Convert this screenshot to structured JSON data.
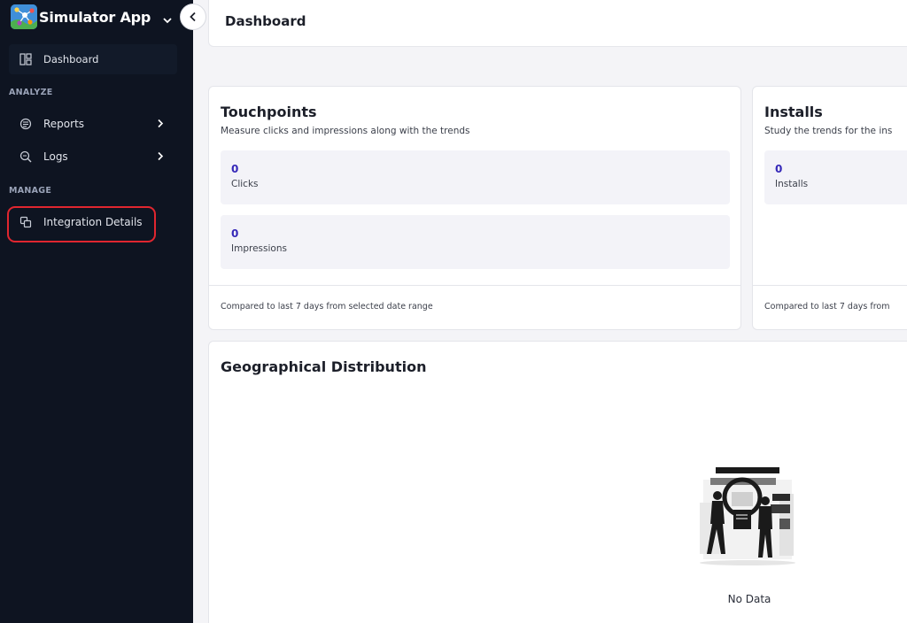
{
  "app": {
    "name": "Simulator App",
    "logo_icon": "network-graph-icon",
    "switcher_icon": "chevron-down-icon"
  },
  "sidebar": {
    "collapse_icon": "chevron-left-icon",
    "items": [
      {
        "label": "Dashboard",
        "icon": "dashboard-layout-icon",
        "active": true
      },
      {
        "label": "Reports",
        "icon": "report-icon",
        "has_submenu": true
      },
      {
        "label": "Logs",
        "icon": "search-log-icon",
        "has_submenu": true
      },
      {
        "label": "Integration Details",
        "icon": "copy-integration-icon",
        "highlighted": true
      }
    ],
    "sections": {
      "analyze": "ANALYZE",
      "manage": "MANAGE"
    }
  },
  "header": {
    "title": "Dashboard"
  },
  "touchpoints": {
    "title": "Touchpoints",
    "subtitle": "Measure clicks and impressions along with the trends",
    "metrics": [
      {
        "value": "0",
        "label": "Clicks"
      },
      {
        "value": "0",
        "label": "Impressions"
      }
    ],
    "footer": "Compared to last 7 days from selected date range"
  },
  "installs": {
    "title": "Installs",
    "subtitle": "Study the trends for the ins",
    "metrics": [
      {
        "value": "0",
        "label": "Installs"
      }
    ],
    "footer": "Compared to last 7 days from"
  },
  "geo": {
    "title": "Geographical Distribution",
    "empty_text": "No Data",
    "empty_icon": "no-data-illustration"
  },
  "colors": {
    "sidebar_bg": "#0e1421",
    "accent_value": "#3528b8",
    "highlight_ring": "#e0262f",
    "metric_bg": "#f3f3f8"
  }
}
